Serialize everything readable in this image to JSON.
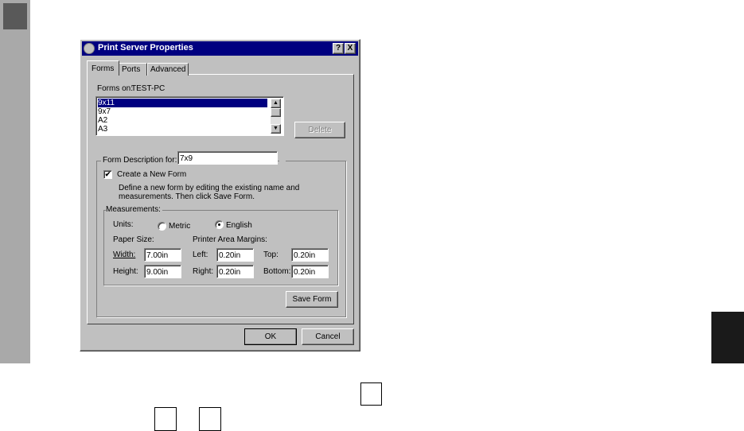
{
  "dialog": {
    "title": "Print Server Properties",
    "help_icon": "?",
    "close_icon": "X",
    "tabs": [
      "Forms",
      "Ports",
      "Advanced"
    ],
    "forms_on_label": "Forms on:",
    "server_name": "TEST-PC",
    "forms_list": [
      "9x11",
      "9x7",
      "A2",
      "A3"
    ],
    "delete_label": "Delete",
    "form_description_label": "Form Description for:",
    "form_description_value": "7x9",
    "create_new_form_label": "Create a New Form",
    "create_new_form_checked": true,
    "help_text_1": "Define a new form by editing the existing name and",
    "help_text_2": "measurements.  Then click Save Form.",
    "measurements_label": "Measurements:",
    "units_label": "Units:",
    "metric_label": "Metric",
    "english_label": "English",
    "selected_unit": "English",
    "paper_size_label": "Paper Size:",
    "margins_label": "Printer Area Margins:",
    "width_label": "Width:",
    "width_value": "7.00in",
    "height_label": "Height:",
    "height_value": "9.00in",
    "left_label": "Left:",
    "left_value": "0.20in",
    "right_label": "Right:",
    "right_value": "0.20in",
    "top_label": "Top:",
    "top_value": "0.20in",
    "bottom_label": "Bottom:",
    "bottom_value": "0.20in",
    "save_form_label": "Save Form",
    "ok_label": "OK",
    "cancel_label": "Cancel"
  }
}
